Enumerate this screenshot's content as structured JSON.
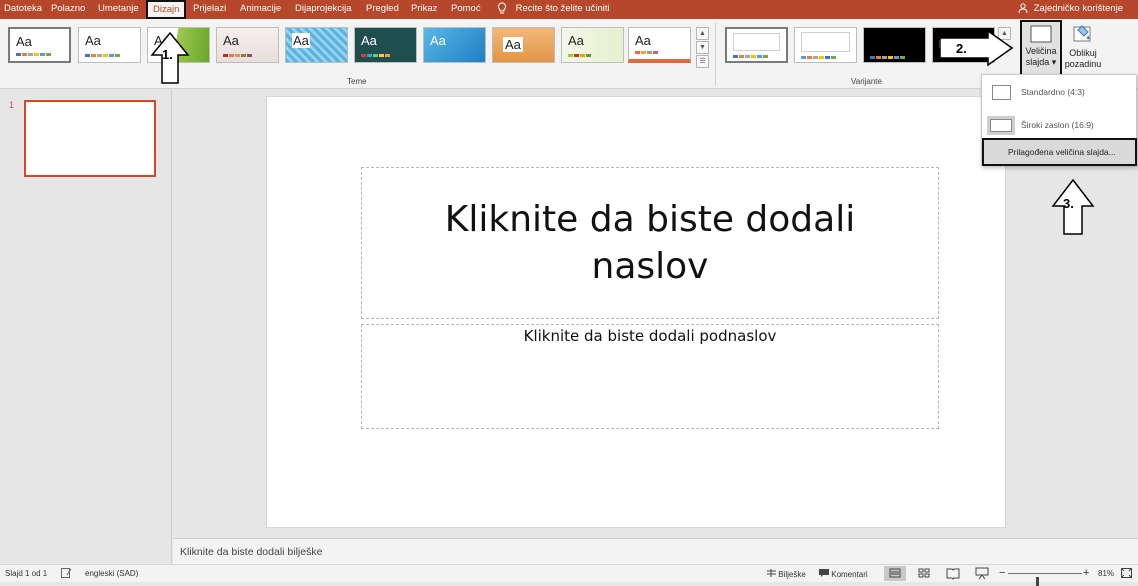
{
  "tabs": [
    "Datoteka",
    "Polazno",
    "Umetanje",
    "Dizajn",
    "Prijelazi",
    "Animacije",
    "Dijaprojekcija",
    "Pregled",
    "Prikaz",
    "Pomoć"
  ],
  "active_tab": "Dizajn",
  "tell_me": "Recite što želite učiniti",
  "share": "Zajedničko korištenje",
  "ribbon": {
    "themes_group_label": "Teme",
    "variants_group_label": "Varijante",
    "theme_sample_text": "Aa",
    "slide_size_label_1": "Veličina",
    "slide_size_label_2": "slajda ▾",
    "format_bg_label_1": "Oblikuj",
    "format_bg_label_2": "pozadinu"
  },
  "slide_size_menu": {
    "standard": "Standardno (4:3)",
    "widescreen": "Široki zaslon (16:9)",
    "custom": "Prilagođena veličina slajda..."
  },
  "callouts": [
    "1.",
    "2.",
    "3."
  ],
  "thumbnails": [
    {
      "number": "1"
    }
  ],
  "slide": {
    "title": "Kliknite da biste dodali naslov",
    "subtitle": "Kliknite da biste dodali podnaslov"
  },
  "notes_placeholder": "Kliknite da biste dodali bilješke",
  "status": {
    "slide_counter": "Slajd 1 od 1",
    "language": "engleski (SAD)",
    "notes": "Bilješke",
    "comments": "Komentari",
    "zoom": "81%",
    "zoom_level": 0.81
  },
  "colors": {
    "accent": "#b7472a",
    "thumb_border": "#d24726"
  }
}
